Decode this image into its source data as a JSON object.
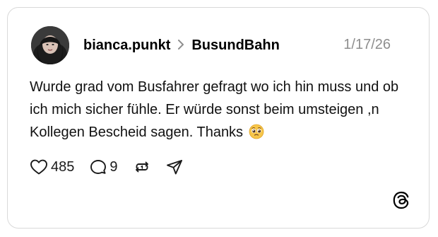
{
  "post": {
    "username": "bianca.punkt",
    "separator": ">",
    "community": "BusundBahn",
    "date": "1/17/26",
    "text": "Wurde grad vom Busfahrer gefragt wo ich hin muss und ob ich mich sicher fühle. Er würde sonst beim umsteigen ,n Kollegen Bescheid sagen. Thanks",
    "emoji": "pleading-face-emoji"
  },
  "actions": {
    "likes": "485",
    "replies": "9",
    "like_icon": "heart-icon",
    "reply_icon": "comment-icon",
    "repost_icon": "repost-icon",
    "share_icon": "send-icon"
  },
  "brand": {
    "logo_icon": "threads-logo-icon"
  },
  "colors": {
    "border": "#d9d9d9",
    "muted": "#8e8e8e",
    "text": "#111111"
  }
}
